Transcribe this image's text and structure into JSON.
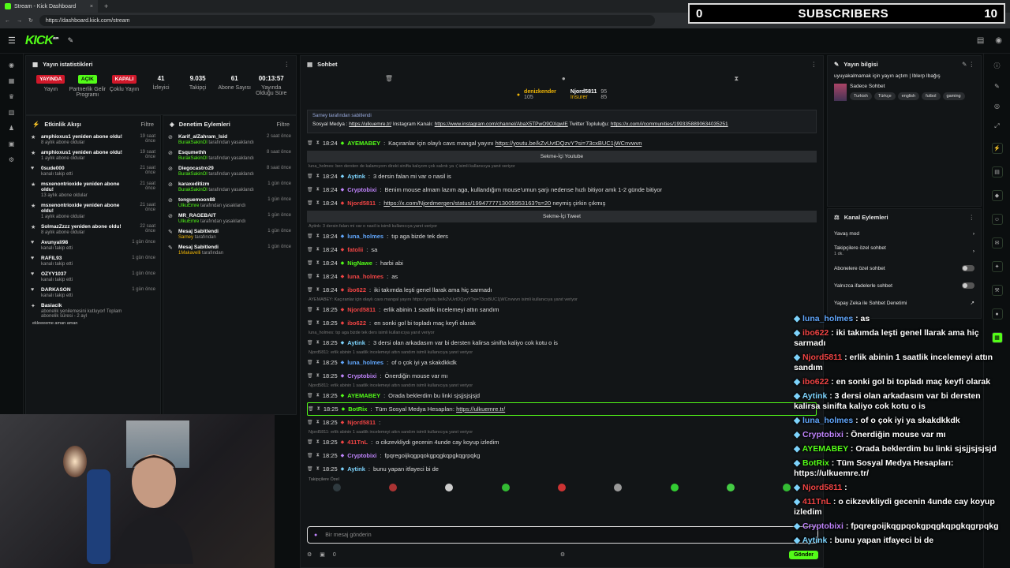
{
  "browser": {
    "tab_title": "Stream - Kick Dashboard",
    "tab_close": "×",
    "new_tab": "+",
    "url": "https://dashboard.kick.com/stream"
  },
  "subscribers": {
    "count": "0",
    "label": "SUBSCRIBERS",
    "goal": "10"
  },
  "nav": {
    "logo": "KICK",
    "logo_sup": "BETA"
  },
  "stats_panel": {
    "title": "Yayın istatistikleri",
    "items": [
      {
        "badge": "YAYINDA",
        "badge_color": "#d0182a",
        "label": "Yayın"
      },
      {
        "badge": "AÇIK",
        "badge_color": "#53fc18",
        "label": "Partnerlik Gelir Programı"
      },
      {
        "badge": "KAPALI",
        "badge_color": "#d0182a",
        "label": "Çoklu Yayın"
      },
      {
        "value": "41",
        "label": "İzleyici"
      },
      {
        "value": "9.035",
        "label": "Takipçi"
      },
      {
        "value": "61",
        "label": "Abone Sayısı"
      },
      {
        "value": "00:13:57",
        "label": "Yayında Olduğu Süre"
      }
    ]
  },
  "activity": {
    "title": "Etkinlik Akışı",
    "filter": "Filtre",
    "items": [
      {
        "title": "amphioxus1 yeniden abone oldu!",
        "sub": "8 aylık abone oldular",
        "time": "19 saat önce",
        "icon": "star"
      },
      {
        "title": "amphioxus1 yeniden abone oldu!",
        "sub": "1 aylık abone oldular",
        "time": "19 saat önce",
        "icon": "star"
      },
      {
        "title": "0sude000",
        "sub": "kanalı takip etti",
        "time": "21 saat önce",
        "icon": "heart"
      },
      {
        "title": "msxenontrioxide yeniden abone oldu!",
        "sub": "13 aylık abone oldular",
        "time": "21 saat önce",
        "icon": "star"
      },
      {
        "title": "msxenontrioxide yeniden abone oldu!",
        "sub": "1 aylık abone oldular",
        "time": "21 saat önce",
        "icon": "star"
      },
      {
        "title": "SolmazZzzz yeniden abone oldu!",
        "sub": "8 aylık abone oldular",
        "time": "22 saat önce",
        "icon": "star"
      },
      {
        "title": "Avunyali98",
        "sub": "kanalı takip etti",
        "time": "1 gün önce",
        "icon": "heart"
      },
      {
        "title": "RAFIL93",
        "sub": "kanalı takip etti",
        "time": "1 gün önce",
        "icon": "heart"
      },
      {
        "title": "OZYY1037",
        "sub": "kanalı takip etti",
        "time": "1 gün önce",
        "icon": "heart"
      },
      {
        "title": "DARKASON",
        "sub": "kanalı takip etti",
        "time": "1 gün önce",
        "icon": "heart"
      },
      {
        "title": "Basiacik",
        "sub": "abonelik yenilemesini kutluyor! Toplam abonelik süresi - 2 ayl",
        "time": "",
        "icon": "gift"
      }
    ],
    "last_line": "ekleeeeme aman aman"
  },
  "moderation": {
    "title": "Denetim Eylemleri",
    "filter": "Filtre",
    "items": [
      {
        "title": "Karif_alZahram_Isid",
        "by": "BurakSakinOl",
        "sub": "tarafından yasaklandı",
        "time": "2 saat önce",
        "icon": "ban"
      },
      {
        "title": "Esqumethh",
        "by": "BurakSakinOl",
        "sub": "tarafından yasaklandı",
        "time": "8 saat önce",
        "icon": "ban"
      },
      {
        "title": "Diegocastro29",
        "by": "BurakSakinOl",
        "sub": "tarafından yasaklandı",
        "time": "8 saat önce",
        "icon": "ban"
      },
      {
        "title": "karaxeditizm",
        "by": "BurakSakinOl",
        "sub": "tarafından yasaklandı",
        "time": "1 gün önce",
        "icon": "ban"
      },
      {
        "title": "tonguemoon88",
        "by": "UlkuEmre",
        "sub": "tarafından yasaklandı",
        "time": "1 gün önce",
        "icon": "ban"
      },
      {
        "title": "MR_RAGEBAIT",
        "by": "UlkuEmre",
        "sub": "tarafından yasaklandı",
        "time": "1 gün önce",
        "icon": "ban"
      },
      {
        "title": "Mesaj Sabitlendi",
        "by": "Sarney",
        "sub": "tarafından",
        "time": "1 gün önce",
        "icon": "pin"
      },
      {
        "title": "Mesaj Sabitlendi",
        "by": "1Makavelli",
        "sub": "tarafından",
        "time": "1 gün önce",
        "icon": "pin"
      }
    ]
  },
  "chat": {
    "title": "Sohbet",
    "donors": [
      {
        "name": "denizkender",
        "value": "105"
      },
      {
        "name": "Njord5811",
        "value": "95"
      },
      {
        "name": "Insurer",
        "value": "85"
      }
    ],
    "pinned": {
      "by": "Sarney",
      "header": "tarafından sabitlendi",
      "prefix": "Sosyal Medya :",
      "links": [
        "https://ulkuemre.tr/",
        "https://www.instagram.com/channel/AbaX5TPwO9OXqwIE",
        "https://x.com/i/communities/1993358890634035251"
      ],
      "mid1": "Instagram Kanalı:",
      "mid2": "Twitter Topluluğu:"
    },
    "messages": [
      {
        "kind": "msg",
        "time": "18:24",
        "user": "AYEMABEY",
        "color": "#53fc18",
        "text": "Kaçıranlar için olaylı cavs mangal yayını",
        "link": "https://youtu.be/kZvUvtDQzvY?si=73cxBUC1jWCnvwvn"
      },
      {
        "kind": "embed",
        "text": "Sekme-İçi Youtube"
      },
      {
        "kind": "reply",
        "text": "luna_holmes: ben dersten de kalamıyom direkt sinifta kalıyom çok salıntı ya :( isimli kullanıcıya yanıt veriyor"
      },
      {
        "kind": "msg",
        "time": "18:24",
        "user": "Aytink",
        "color": "#7dd3fc",
        "text": "3 dersin falan mi var o nasil is"
      },
      {
        "kind": "msg",
        "time": "18:24",
        "user": "Cryptobixi",
        "color": "#c084fc",
        "text": "Benim mouse almam lazım aga, kullandığım mouse'umun şarjı nedense hızlı bitiyor amk 1-2 günde bitiyor"
      },
      {
        "kind": "msg",
        "time": "18:24",
        "user": "Njord5811",
        "color": "#ef4444",
        "text": "",
        "link": "https://x.com/Njordmergen/status/1994777713005953163?s=20",
        "after": "neymiş çirkin çıkmış"
      },
      {
        "kind": "embed",
        "text": "Sekme-İçi Tweet"
      },
      {
        "kind": "reply",
        "text": "Aytink: 3 dersin falan mi var o nasil is isimli kullanıcıya yanıt veriyor"
      },
      {
        "kind": "msg",
        "time": "18:24",
        "user": "luna_holmes",
        "color": "#60a5fa",
        "text": "tıp aga bizde tek ders"
      },
      {
        "kind": "msg",
        "time": "18:24",
        "user": "fatolii",
        "color": "#ef4444",
        "text": "sa"
      },
      {
        "kind": "msg",
        "time": "18:24",
        "user": "NigNawe",
        "color": "#53fc18",
        "text": "harbi abi"
      },
      {
        "kind": "msg",
        "time": "18:24",
        "user": "luna_holmes",
        "color": "#ef4444",
        "text": "as"
      },
      {
        "kind": "msg",
        "time": "18:24",
        "user": "ibo622",
        "color": "#ef4444",
        "text": "iki takımda leşti genel llarak ama hiç sarmadı"
      },
      {
        "kind": "reply",
        "text": "AYEMABEY: Kaçıranlar için olaylı cavs mangal yayını https://youtu.be/kZvUvtDQzvY?si=73cxBUC1jWCnvwvn isimli kullanıcıya yanıt veriyor"
      },
      {
        "kind": "msg",
        "time": "18:25",
        "user": "Njord5811",
        "color": "#ef4444",
        "text": "erlik abinin 1 saatlik incelemeyi attın sandım"
      },
      {
        "kind": "msg",
        "time": "18:25",
        "user": "ibo622",
        "color": "#ef4444",
        "text": "en sonki gol bi topladı maç keyfi olarak"
      },
      {
        "kind": "reply",
        "text": "luna_holmes: tıp aga bizde tek ders isimli kullanıcıya yanıt veriyor"
      },
      {
        "kind": "msg",
        "time": "18:25",
        "user": "Aytink",
        "color": "#7dd3fc",
        "text": "3 dersi olan arkadasım var bi dersten kalirsa sinifta kaliyo cok kotu o is"
      },
      {
        "kind": "reply",
        "text": "Njord5811: erlik abinin 1 saatlik incelemeyi attın sandım isimli kullanıcıya yanıt veriyor"
      },
      {
        "kind": "msg",
        "time": "18:25",
        "user": "luna_holmes",
        "color": "#60a5fa",
        "text": "of o çok iyi ya skakdkkdk"
      },
      {
        "kind": "msg",
        "time": "18:25",
        "user": "Cryptobixi",
        "color": "#c084fc",
        "text": "Önerdiğin mouse var mı"
      },
      {
        "kind": "reply",
        "text": "Njord5811: erlik abinin 1 saatlik incelemeyi attın sandım isimli kullanıcıya yanıt veriyor"
      },
      {
        "kind": "msg",
        "time": "18:25",
        "user": "AYEMABEY",
        "color": "#53fc18",
        "text": "Orada beklerdim bu linki sjsjjsjsjsjd"
      },
      {
        "kind": "msg",
        "time": "18:25",
        "user": "BotRix",
        "color": "#53fc18",
        "text": "Tüm Sosyal Medya Hesapları:",
        "link": "https://ulkuemre.tr/",
        "highlight": true
      },
      {
        "kind": "msg",
        "time": "18:25",
        "user": "Njord5811",
        "color": "#ef4444",
        "text": ""
      },
      {
        "kind": "reply",
        "text": "Njord5811: erlik abinin 1 saatlik incelemeyi attın sandım isimli kullanıcıya yanıt veriyor"
      },
      {
        "kind": "msg",
        "time": "18:25",
        "user": "411TnL",
        "color": "#ef4444",
        "text": "o cikzevkliydi gecenin 4unde cay koyup izledim"
      },
      {
        "kind": "msg",
        "time": "18:25",
        "user": "Cryptobixi",
        "color": "#c084fc",
        "text": "fpqregoijkqgpqokgpqgkqpgkqgrpqkg"
      },
      {
        "kind": "msg",
        "time": "18:25",
        "user": "Aytink",
        "color": "#7dd3fc",
        "text": "bunu yapan itfayeci bi de"
      }
    ],
    "followers_only": "Takipçilere Özel",
    "input_placeholder": "Bir mesaj gönderin",
    "footer_count": "0",
    "send": "Gönder"
  },
  "stream_info": {
    "title": "Yayın bilgisi",
    "stream_title": "uyuyakalmamak için yayın açtım | Iblerp Ibağış",
    "category": "Sadece Sohbet",
    "tags": [
      "Turkish",
      "Türkçe",
      "english",
      "futbol",
      "gaming"
    ]
  },
  "channel_actions": {
    "title": "Kanal Eylemleri",
    "items": [
      {
        "label": "Yavaş mod",
        "type": "arrow"
      },
      {
        "label": "Takipçilere özel sohbet",
        "sub": "1 dk.",
        "type": "arrow"
      },
      {
        "label": "Abonelere özel sohbet",
        "type": "toggle"
      },
      {
        "label": "Yalnızca ifadelerle sohbet",
        "type": "toggle"
      },
      {
        "label": "Yapay Zeka ile Sohbet Denetimi",
        "type": "link"
      }
    ]
  },
  "overlay": {
    "messages": [
      {
        "user": "luna_holmes",
        "color": "#60a5fa",
        "text": "as"
      },
      {
        "user": "ibo622",
        "color": "#ef4444",
        "text": "iki takımda leşti genel llarak ama hiç sarmadı"
      },
      {
        "user": "Njord5811",
        "color": "#ef4444",
        "text": "erlik abinin 1 saatlik incelemeyi attın sandım"
      },
      {
        "user": "ibo622",
        "color": "#ef4444",
        "text": "en sonki gol bi topladı maç keyfi olarak"
      },
      {
        "user": "Aytink",
        "color": "#7dd3fc",
        "text": "3 dersi olan arkadasım var bi dersten kalirsa sinifta kaliyo cok kotu o is"
      },
      {
        "user": "luna_holmes",
        "color": "#60a5fa",
        "text": "of o çok iyi ya skakdkkdk"
      },
      {
        "user": "Cryptobixi",
        "color": "#c084fc",
        "text": "Önerdiğin mouse var mı"
      },
      {
        "user": "AYEMABEY",
        "color": "#53fc18",
        "text": "Orada beklerdim bu linki sjsjjsjsjsjd"
      },
      {
        "user": "BotRix",
        "color": "#53fc18",
        "text": "Tüm Sosyal Medya Hesapları: https://ulkuemre.tr/"
      },
      {
        "user": "Njord5811",
        "color": "#ef4444",
        "text": ""
      },
      {
        "user": "411TnL",
        "color": "#ef4444",
        "text": "o cikzevkliydi gecenin 4unde cay koyup izledim"
      },
      {
        "user": "Cryptobixi",
        "color": "#c084fc",
        "text": "fpqregoijkqgpqokgpqgkqpgkqgrpqkg"
      },
      {
        "user": "Aytink",
        "color": "#7dd3fc",
        "text": "bunu yapan itfayeci bi de"
      }
    ]
  }
}
